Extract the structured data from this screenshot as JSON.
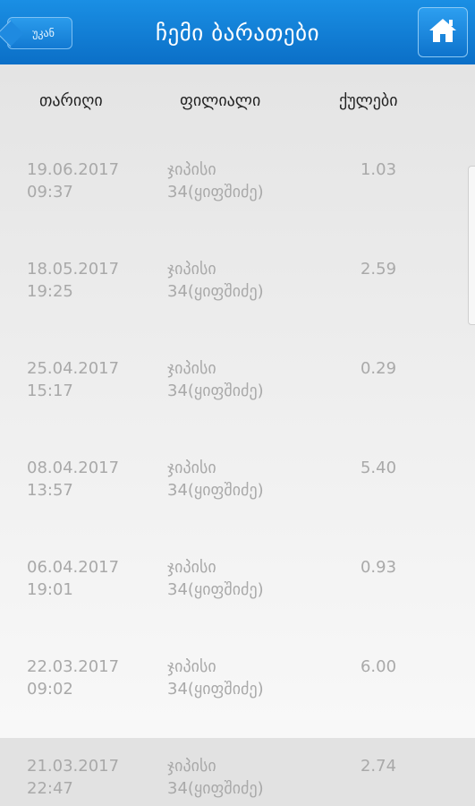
{
  "header": {
    "back_label": "უკან",
    "title": "ჩემი ბარათები"
  },
  "columns": {
    "date": "თარიღი",
    "branch": "ფილიალი",
    "points": "ქულები"
  },
  "rows": [
    {
      "date": "19.06.2017",
      "time": "09:37",
      "branch_line1": "ჯიპისი",
      "branch_line2": "34(ყიფშიძე)",
      "points": "1.03"
    },
    {
      "date": "18.05.2017",
      "time": "19:25",
      "branch_line1": "ჯიპისი",
      "branch_line2": "34(ყიფშიძე)",
      "points": "2.59"
    },
    {
      "date": "25.04.2017",
      "time": "15:17",
      "branch_line1": "ჯიპისი",
      "branch_line2": "34(ყიფშიძე)",
      "points": "0.29"
    },
    {
      "date": "08.04.2017",
      "time": "13:57",
      "branch_line1": "ჯიპისი",
      "branch_line2": "34(ყიფშიძე)",
      "points": "5.40"
    },
    {
      "date": "06.04.2017",
      "time": "19:01",
      "branch_line1": "ჯიპისი",
      "branch_line2": "34(ყიფშიძე)",
      "points": "0.93"
    },
    {
      "date": "22.03.2017",
      "time": "09:02",
      "branch_line1": "ჯიპისი",
      "branch_line2": "34(ყიფშიძე)",
      "points": "6.00"
    },
    {
      "date": "21.03.2017",
      "time": "22:47",
      "branch_line1": "ჯიპისი",
      "branch_line2": "34(ყიფშიძე)",
      "points": "2.74"
    }
  ],
  "icons": {
    "home": "home-icon"
  },
  "colors": {
    "accent": "#0b6fc7",
    "row_text": "#a9a9a9"
  }
}
